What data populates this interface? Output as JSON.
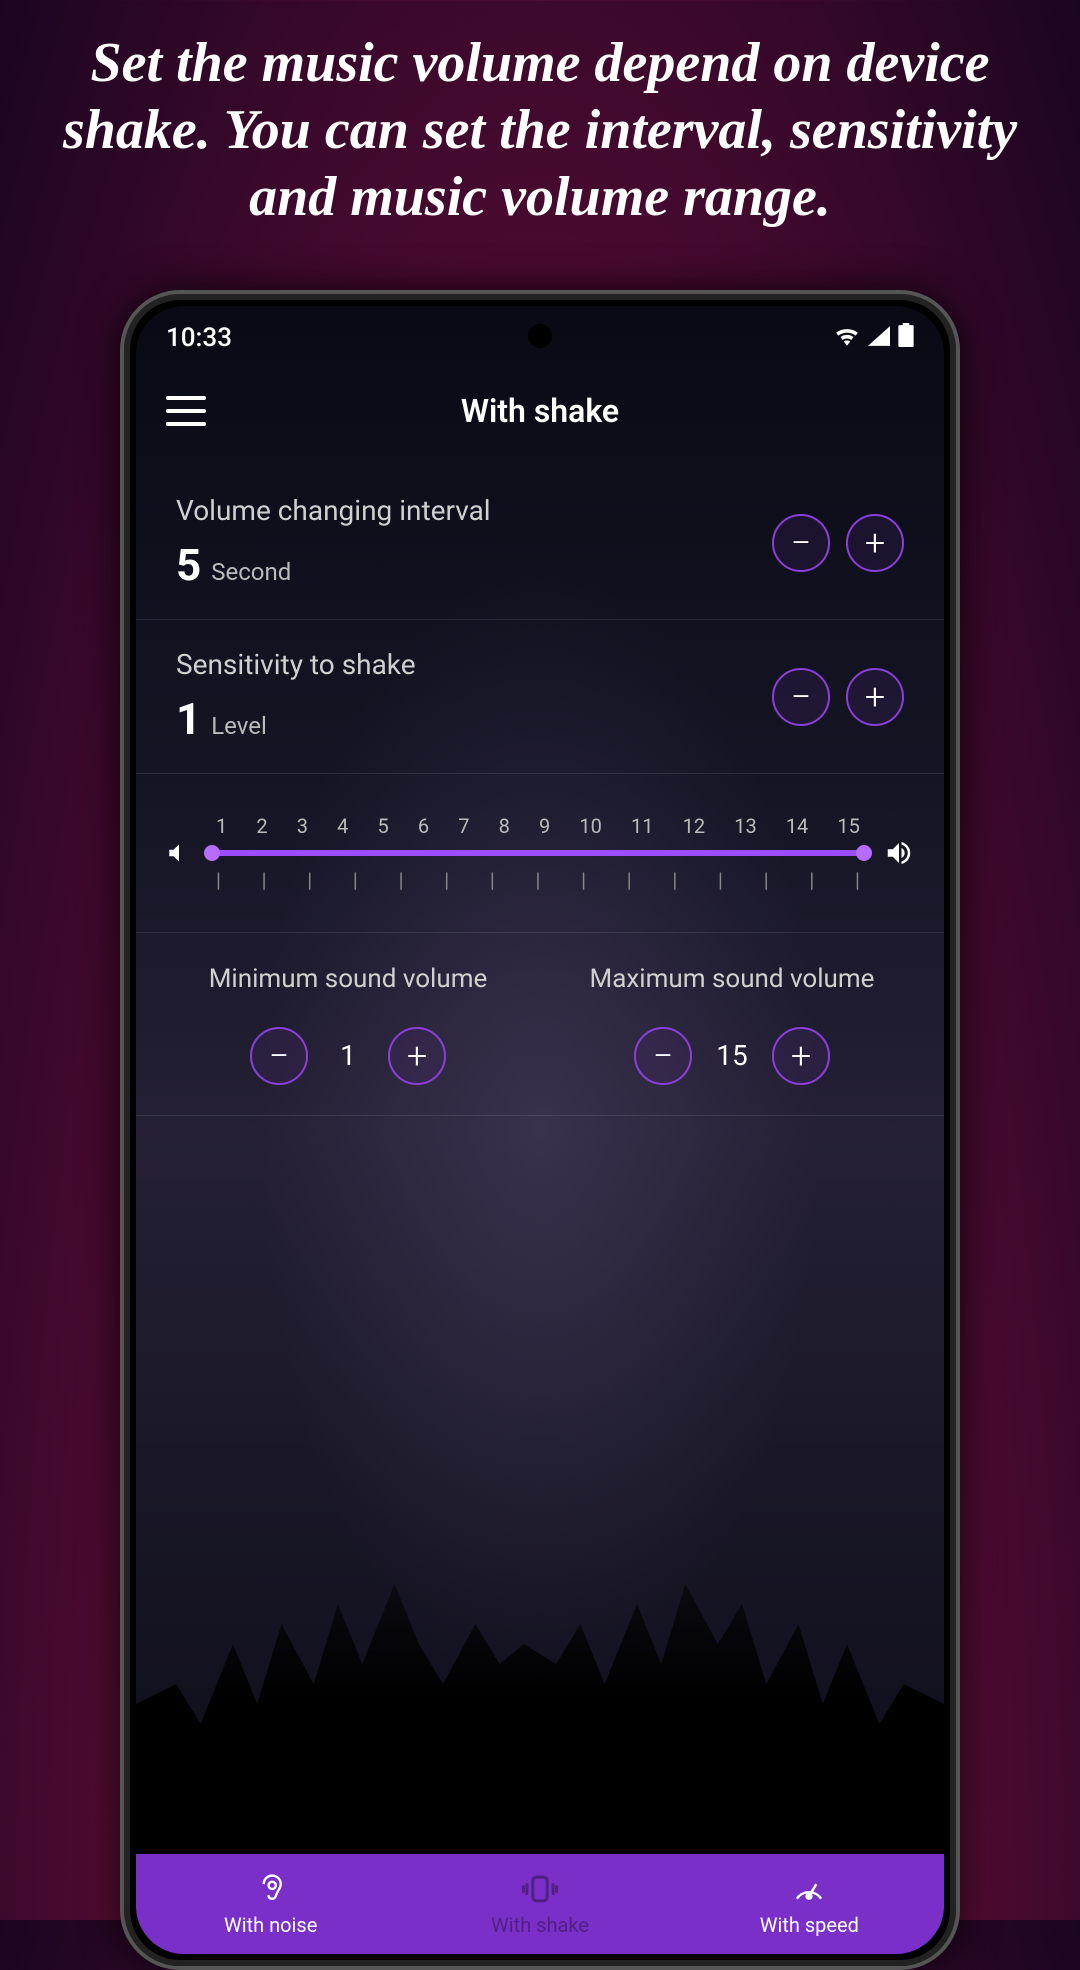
{
  "headline": "Set the music volume depend on device shake. You can set the interval, sensitivity and music volume range.",
  "status": {
    "time": "10:33"
  },
  "app": {
    "title": "With shake"
  },
  "interval": {
    "label": "Volume changing interval",
    "value": "5",
    "unit": "Second"
  },
  "sensitivity": {
    "label": "Sensitivity to shake",
    "value": "1",
    "unit": "Level"
  },
  "slider": {
    "ticks": [
      "1",
      "2",
      "3",
      "4",
      "5",
      "6",
      "7",
      "8",
      "9",
      "10",
      "11",
      "12",
      "13",
      "14",
      "15"
    ]
  },
  "min": {
    "label": "Minimum sound volume",
    "value": "1"
  },
  "max": {
    "label": "Maximum sound volume",
    "value": "15"
  },
  "nav": {
    "noise": "With noise",
    "shake": "With shake",
    "speed": "With speed"
  },
  "glyphs": {
    "minus": "−",
    "plus": "+",
    "tick": "|"
  }
}
